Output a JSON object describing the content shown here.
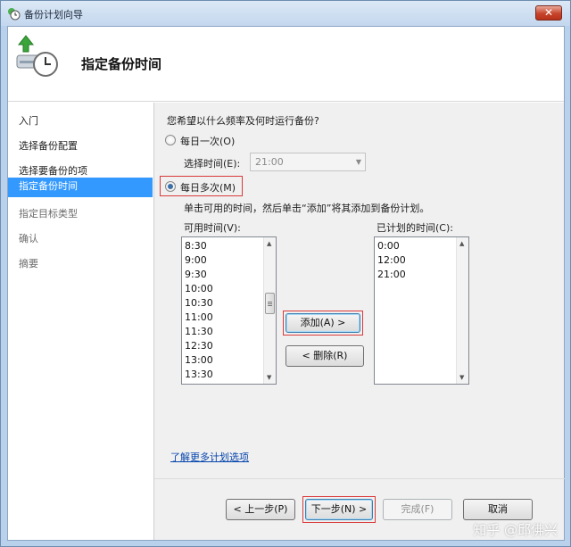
{
  "window": {
    "title": "备份计划向导",
    "close_glyph": "✕"
  },
  "header": {
    "title": "指定备份时间",
    "icon": "backup-clock-icon"
  },
  "sidebar": {
    "items": [
      {
        "label": "入门",
        "state": "normal"
      },
      {
        "label": "选择备份配置",
        "state": "normal"
      },
      {
        "label": "选择要备份的项",
        "state": "normal"
      },
      {
        "label": "指定备份时间",
        "state": "selected"
      },
      {
        "label": "指定目标类型",
        "state": "dim"
      },
      {
        "label": "确认",
        "state": "dim"
      },
      {
        "label": "摘要",
        "state": "dim"
      }
    ]
  },
  "main": {
    "question": "您希望以什么频率及何时运行备份?",
    "once_daily": {
      "label": "每日一次(O)",
      "checked": false
    },
    "select_time": {
      "label": "选择时间(E):",
      "value": "21:00"
    },
    "multi_daily": {
      "label": "每日多次(M)",
      "checked": true
    },
    "instruction": "单击可用的时间，然后单击“添加”将其添加到备份计划。",
    "available": {
      "label": "可用时间(V):",
      "items": [
        "8:30",
        "9:00",
        "9:30",
        "10:00",
        "10:30",
        "11:00",
        "11:30",
        "12:30",
        "13:00",
        "13:30"
      ]
    },
    "scheduled": {
      "label": "已计划的时间(C):",
      "items": [
        "0:00",
        "12:00",
        "21:00"
      ]
    },
    "add_button": "添加(A) >",
    "remove_button": "< 删除(R)",
    "more_link": "了解更多计划选项"
  },
  "footer": {
    "back": "< 上一步(P)",
    "next": "下一步(N) >",
    "finish": "完成(F)",
    "cancel": "取消"
  },
  "watermark": "知乎 @邱佛兴",
  "colors": {
    "selection": "#3399ff",
    "highlight_box": "#d93a3a",
    "link": "#0645ad"
  }
}
